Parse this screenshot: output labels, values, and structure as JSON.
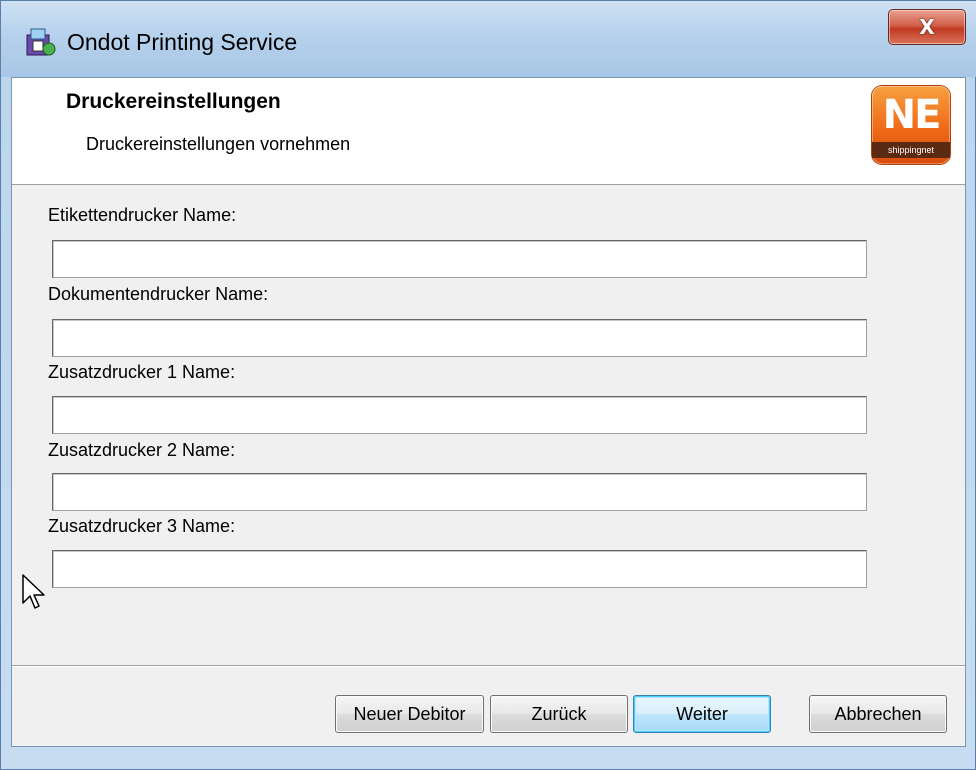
{
  "window": {
    "title": "Ondot Printing Service",
    "close_label": "X"
  },
  "header": {
    "title": "Druckereinstellungen",
    "subtitle": "Druckereinstellungen vornehmen",
    "logo_letters": "NE",
    "logo_caption": "shippingnet"
  },
  "fields": [
    {
      "label": "Etikettendrucker Name:",
      "value": ""
    },
    {
      "label": "Dokumentendrucker Name:",
      "value": ""
    },
    {
      "label": "Zusatzdrucker 1 Name:",
      "value": ""
    },
    {
      "label": "Zusatzdrucker 2 Name:",
      "value": ""
    },
    {
      "label": "Zusatzdrucker 3 Name:",
      "value": ""
    }
  ],
  "buttons": {
    "new_debitor": "Neuer Debitor",
    "back": "Zurück",
    "next": "Weiter",
    "cancel": "Abbrechen"
  },
  "colors": {
    "logo_orange": "#ef6a18",
    "close_red": "#c13a22",
    "default_button_border": "#3c7fb1"
  }
}
